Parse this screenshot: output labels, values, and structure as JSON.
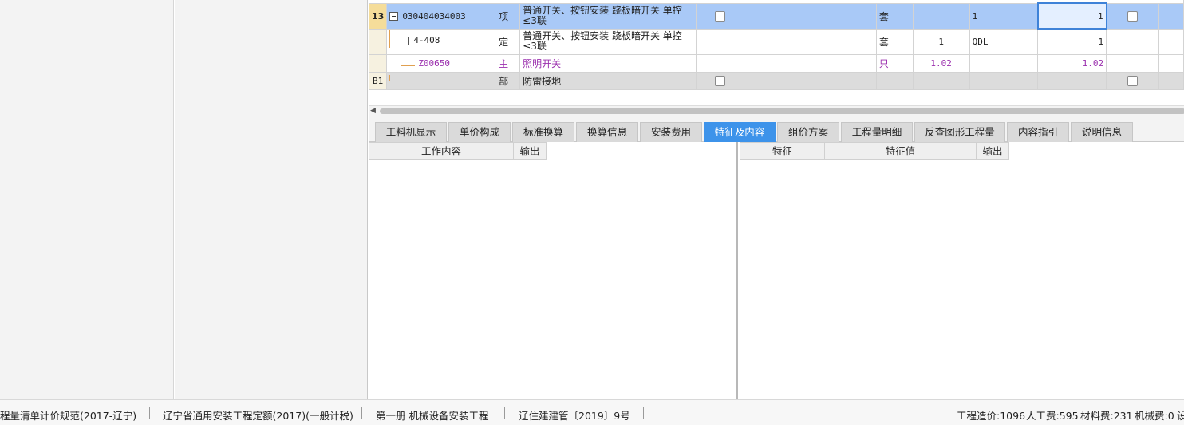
{
  "grid": {
    "rows": [
      {
        "num": "13",
        "code": "030404034003",
        "type": "项",
        "name": "普通开关、按钮安装 跷板暗开关 单控≤3联",
        "unit": "套",
        "qty_expr": "",
        "formula": "1",
        "quantity": "1"
      },
      {
        "num": "",
        "code": "4-408",
        "type": "定",
        "name": "普通开关、按钮安装 跷板暗开关 单控≤3联",
        "unit": "套",
        "qty_expr": "1",
        "formula": "QDL",
        "quantity": "1"
      },
      {
        "num": "",
        "code": "Z00650",
        "type": "主",
        "name": "照明开关",
        "unit": "只",
        "qty_expr": "1.02",
        "formula": "",
        "quantity": "1.02"
      },
      {
        "num": "B1",
        "code": "",
        "type": "部",
        "name": "防雷接地",
        "unit": "",
        "qty_expr": "",
        "formula": "",
        "quantity": ""
      }
    ]
  },
  "tabs": [
    "工料机显示",
    "单价构成",
    "标准换算",
    "换算信息",
    "安装费用",
    "特征及内容",
    "组价方案",
    "工程量明细",
    "反查图形工程量",
    "内容指引",
    "说明信息"
  ],
  "active_tab": "特征及内容",
  "left_pane": {
    "col_work": "工作内容",
    "col_output": "输出"
  },
  "right_pane": {
    "col_feature": "特征",
    "col_value": "特征值",
    "col_output": "输出"
  },
  "status": {
    "spec": "程量清单计价规范(2017-辽宁)",
    "quota": "辽宁省通用安装工程定额(2017)(一般计税)",
    "volume": "第一册 机械设备安装工程",
    "doc": "辽住建建管〔2019〕9号",
    "total": "工程造价:1096",
    "labor": "人工费:595",
    "material": "材料费:231",
    "machine": "机械费:0",
    "trailing": "设"
  },
  "colors": {
    "selected_row": "#a9c9f7",
    "active_tab": "#3d93ea",
    "main_material_text": "#9b2fae"
  }
}
